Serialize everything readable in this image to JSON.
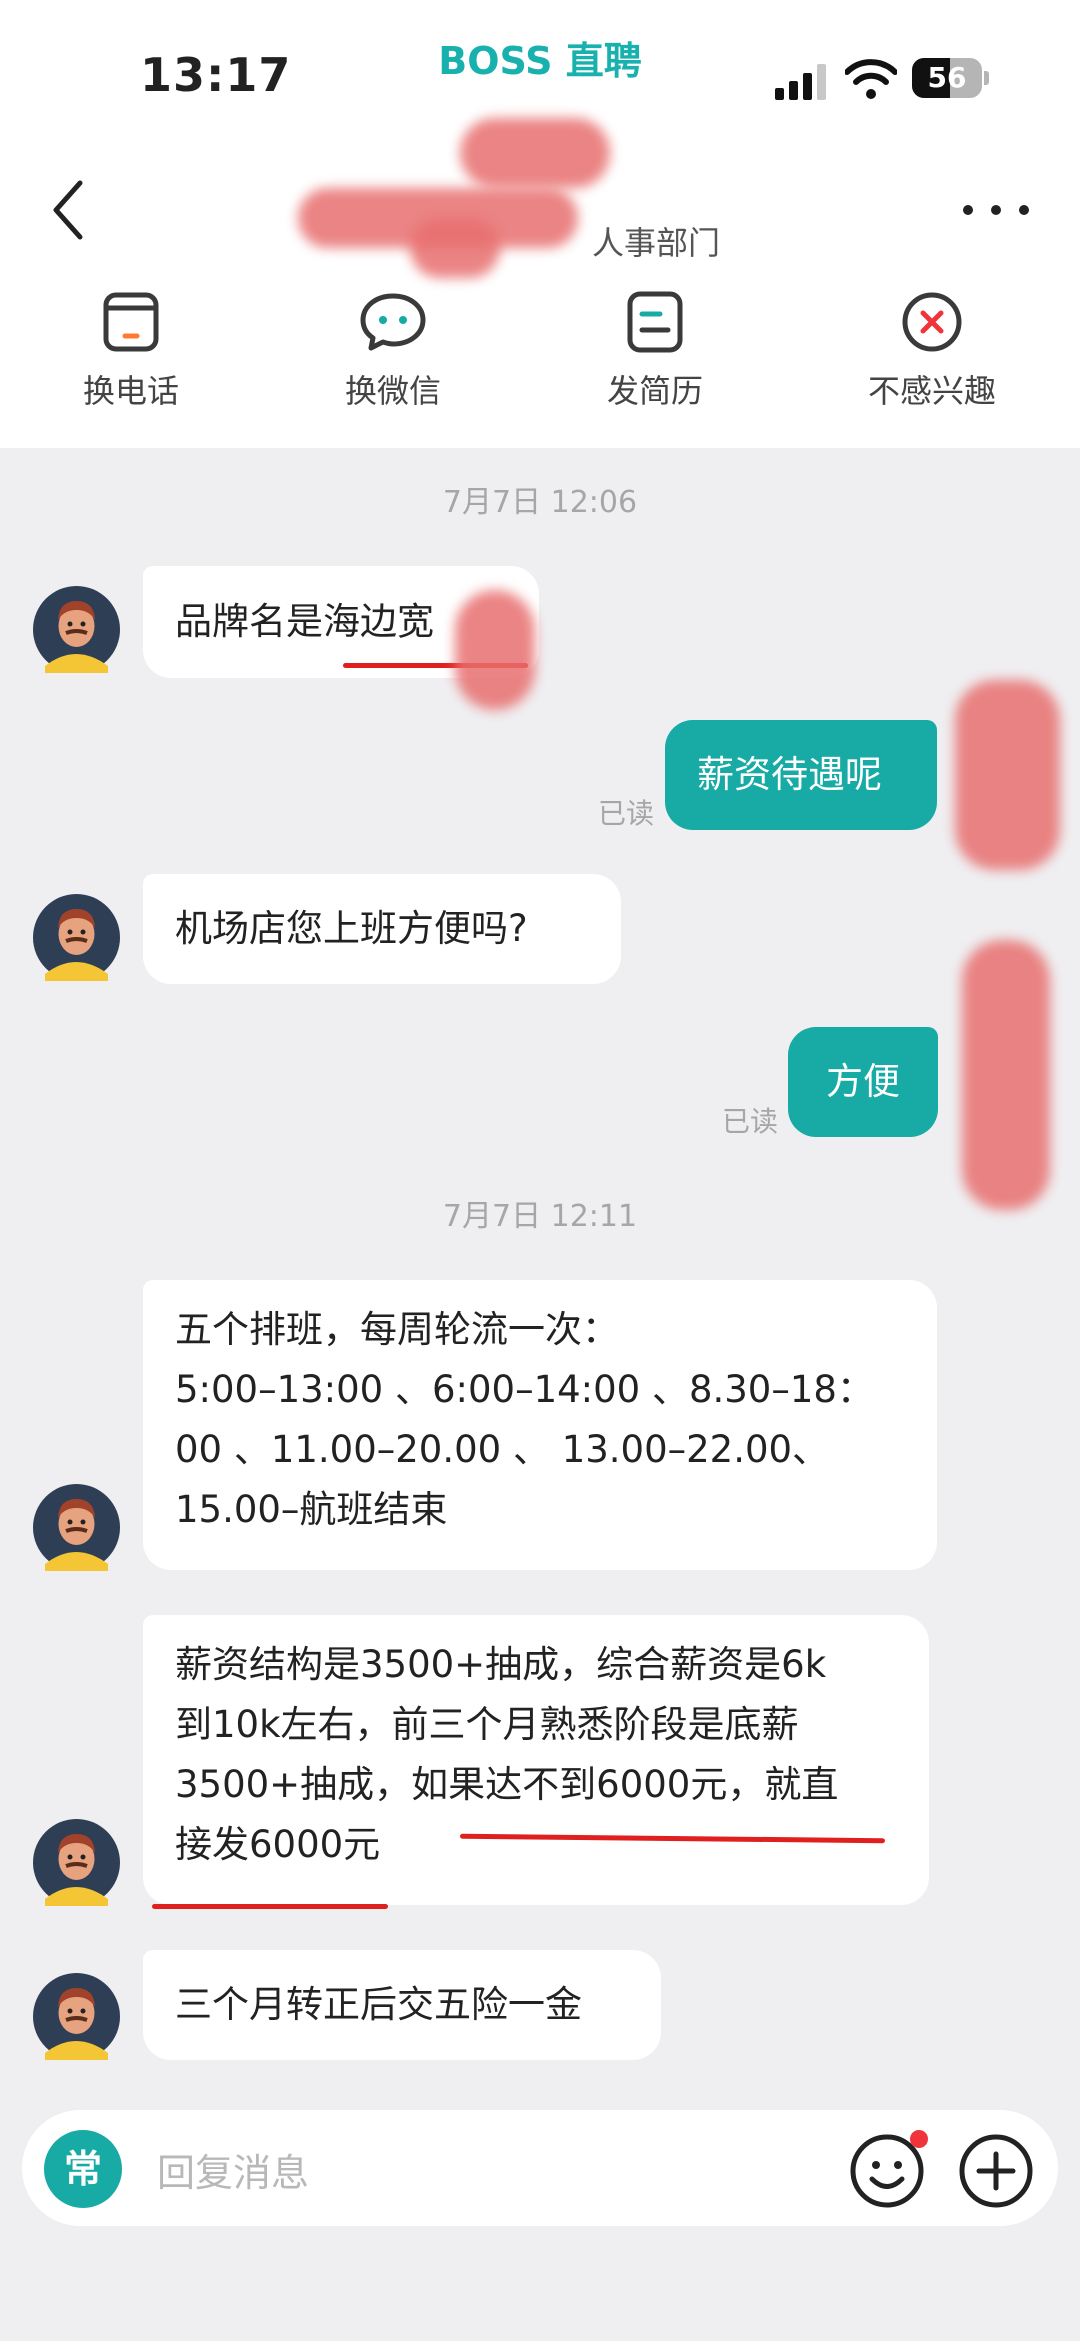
{
  "status": {
    "time": "13:17",
    "battery": "56",
    "app_brand": "BOSS 直聘"
  },
  "header": {
    "department": "人事部门"
  },
  "actions": [
    {
      "label": "换电话",
      "icon": "phone-card-icon"
    },
    {
      "label": "换微信",
      "icon": "wechat-icon"
    },
    {
      "label": "发简历",
      "icon": "resume-icon"
    },
    {
      "label": "不感兴趣",
      "icon": "not-interested-icon"
    }
  ],
  "chat": {
    "time1": "7月7日 12:06",
    "msg1": "品牌名是海边宽",
    "msg2": "薪资待遇呢",
    "read2": "已读",
    "msg3": "机场店您上班方便吗?",
    "msg4": "方便",
    "read4": "已读",
    "time2": "7月7日 12:11",
    "msg5_lines": [
      "五个排班，每周轮流一次：",
      "5:00–13:00 、6:00–14:00 、8.30–18：",
      "00  、11.00–20.00 、 13.00–22.00、",
      "15.00–航班结束"
    ],
    "msg6_lines": [
      "薪资结构是3500+抽成，综合薪资是6k",
      "到10k左右，前三个月熟悉阶段是底薪",
      "3500+抽成，如果达不到6000元，就直",
      "接发6000元"
    ],
    "msg7": "三个月转正后交五险一金"
  },
  "input": {
    "quick_label": "常",
    "placeholder": "回复消息"
  },
  "colors": {
    "brand": "#18aaa5",
    "annotation": "#e0201e"
  }
}
